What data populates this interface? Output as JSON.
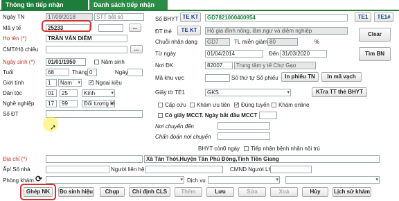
{
  "tabs": [
    "Thông tin tiếp nhận",
    "Danh sách tiếp nhận"
  ],
  "left": {
    "ngay_tn_label": "Ngày TN",
    "ngay_tn": "17/09/2018",
    "stt_placeholder": "STT bắt số",
    "ma_yte_label": "Mã y tế",
    "ma_yte": "25233",
    "hoten_label": "Họ tên (*)",
    "hoten": "TRẦN VĂN DIỄM",
    "cmt_label": "CMT/Hộ chiếu",
    "ngaysinh_label": "Ngày sinh (*)",
    "ngaysinh": "01/01/1950",
    "namsinh_label": "Năm sinh",
    "tuoi_label": "Tuổi",
    "tuoi": "68",
    "thang_label": "Tháng",
    "thang": "0",
    "ngay_label": "Ngày",
    "gioitinh_label": "Giới tính",
    "gioitinh_code": "1",
    "gioitinh": "Nam",
    "ngoaikieu_label": "Ngoại kiều",
    "dantoc_label": "Dân tộc",
    "dantoc_code": "01",
    "dantoc_code2": "25",
    "dantoc": "Kinh",
    "nghenghiep_label": "Nghề nghiệp",
    "nghenghiep_code": "17",
    "nghenghiep_code2": "99",
    "nghenghiep": "Đối tượng kh",
    "sodt_label": "Số ĐT",
    "diachi_label": "Địa chỉ (*)",
    "diachi": "Xã Tân Thới,Huyện Tân Phú Đông,Tỉnh Tiền Giang",
    "apso_label": "Ấp/ Số nhà",
    "nguoilienhe_label": "Người liên hệ",
    "cmnd_label": "CMND Người LH",
    "phongkham_label": "Phòng khám",
    "dichvu_label": "Dịch vụ"
  },
  "right": {
    "sobhyt_label": "Số BHYT",
    "tekt_btn": "TE KT",
    "sobhyt": "GD7821000400954",
    "te1_btn": "TE1",
    "te1hash_btn": "TE1#",
    "dt_the_label": "ĐT thẻ",
    "tekt2_btn": "TE KT",
    "dt_the": "Hộ gia đình nông, lâm,ngư và diêm nghiệp",
    "chuoi_label": "Chuỗi nhận dạng",
    "chuoi": "GD7",
    "tlmg_label": "TL miễn giảm",
    "tlmg": "80",
    "pct": "%",
    "clear_btn": "Clear",
    "tungay_label": "Từ ngày",
    "tungay": "01/04/2014",
    "den_label": "Đến",
    "denngay": "31/03/2020",
    "noidk_label": "Nơi ĐK",
    "noidk_code": "82007",
    "noidk": "Trung tâm y tế Chợ Gạo",
    "timbn_btn": "Tìm BN",
    "makv_label": "Mã khu vực",
    "sothutu_label": "Số thứ tự Số phiếu",
    "inphieu_btn": "In phiếu TN",
    "inmavach_btn": "In mã vạch",
    "giayto_label": "Giấy tờ TE1",
    "giayto": "GKS",
    "ktra_btn": "KTra TT thẻ BHYT",
    "capcuu_label": "Cấp cứu",
    "khamuutien_label": "Khám ưu tiên",
    "dungtuyen_label": "Đúng tuyến",
    "khamonline_label": "Khám online",
    "mcct_label": "Có giấy MCCT. Ngày bắt đầu MCCT",
    "noichuyen_label": "Nơi chuyển đến",
    "chandoan_label": "Chẩn đoán nơi chuyển",
    "bhyt_con_label": "BHYT còn:",
    "bhyt_con": "0 ngày",
    "tiepnhan_label": "Tiếp nhận bệnh nhân nội trú"
  },
  "toolbar": [
    "Ghép NK",
    "Đo sinh hiệu",
    "Chụp",
    "Chỉ định CLS",
    "Thêm",
    "Lưu",
    "Sửa",
    "Xoá",
    "Hủy",
    "Lịch sử khám"
  ],
  "colors": {
    "tab": "#1e7d3a",
    "highlight": "#d0312d",
    "required_label": "#c0392b"
  }
}
